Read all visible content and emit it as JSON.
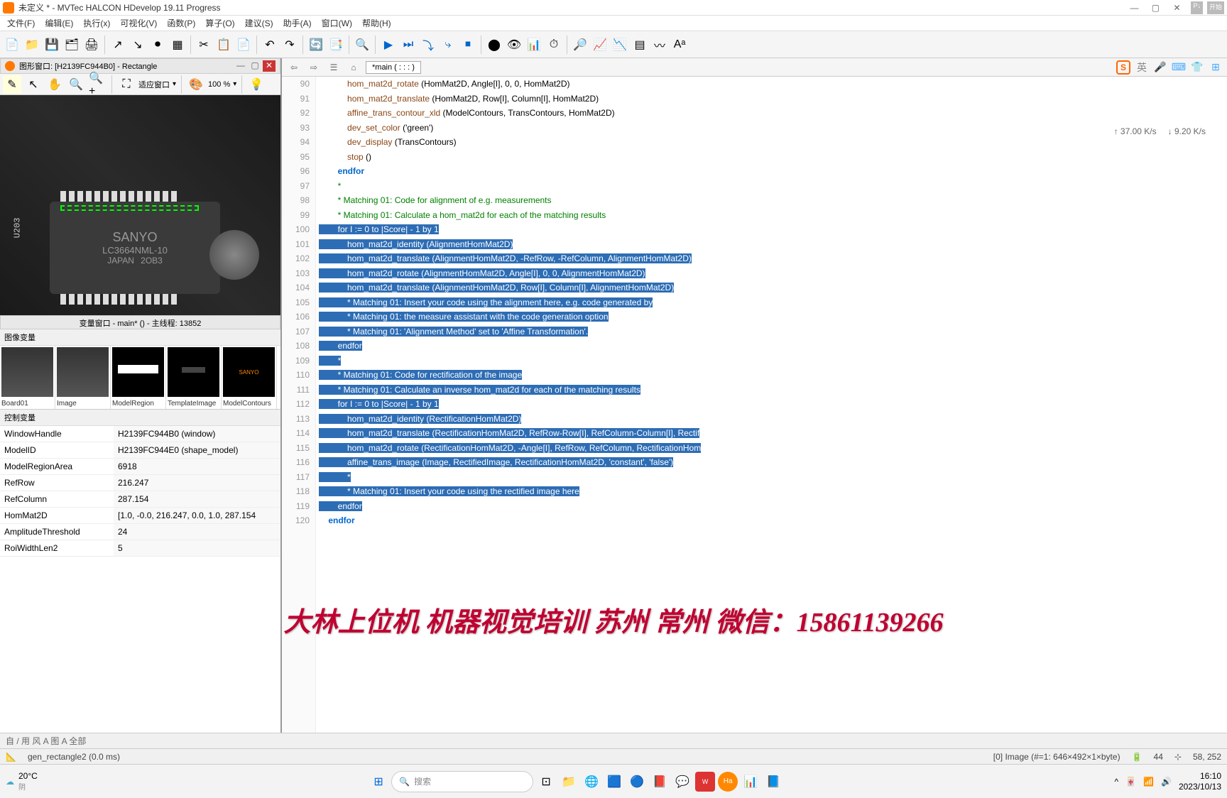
{
  "title": "未定义 * - MVTec HALCON HDevelop 19.11 Progress",
  "start_btn": "开始",
  "menu": [
    "文件(F)",
    "编辑(E)",
    "执行(x)",
    "可视化(V)",
    "函数(P)",
    "算子(O)",
    "建议(S)",
    "助手(A)",
    "窗口(W)",
    "帮助(H)"
  ],
  "graphics_window": {
    "title": "图形窗口: [H2139FC944B0] - Rectangle",
    "zoom": "100 %",
    "fit": "适应窗口"
  },
  "chip": {
    "brand": "SANYO",
    "part": "LC3664NML-10",
    "origin": "JAPAN",
    "code": "2OB3",
    "ref": "U203"
  },
  "var_window_title": "变量窗口 - main* () - 主线程: 13852",
  "thumbs": [
    {
      "label": "Board01"
    },
    {
      "label": "Image"
    },
    {
      "label": "ModelRegion"
    },
    {
      "label": "TemplateImage"
    },
    {
      "label": "ModelContours"
    }
  ],
  "img_var_label": "图像变量",
  "ctrl_var_label": "控制变量",
  "vars": [
    {
      "k": "WindowHandle",
      "v": "H2139FC944B0 (window)"
    },
    {
      "k": "ModelID",
      "v": "H2139FC944E0 (shape_model)"
    },
    {
      "k": "ModelRegionArea",
      "v": "6918"
    },
    {
      "k": "RefRow",
      "v": "216.247"
    },
    {
      "k": "RefColumn",
      "v": "287.154"
    },
    {
      "k": "HomMat2D",
      "v": "[1.0, -0.0, 216.247, 0.0, 1.0, 287.154"
    },
    {
      "k": "AmplitudeThreshold",
      "v": "24"
    },
    {
      "k": "RoiWidthLen2",
      "v": "5"
    }
  ],
  "code_tab": "*main ( : : : )",
  "netstat": {
    "up": "37.00 K/s",
    "down": "9.20 K/s"
  },
  "lang": "英",
  "lines": [
    {
      "n": 90,
      "t": "            hom_mat2d_rotate (HomMat2D, Angle[I], 0, 0, HomMat2D)",
      "sel": false
    },
    {
      "n": 91,
      "t": "            hom_mat2d_translate (HomMat2D, Row[I], Column[I], HomMat2D)",
      "sel": false
    },
    {
      "n": 92,
      "t": "            affine_trans_contour_xld (ModelContours, TransContours, HomMat2D)",
      "sel": false
    },
    {
      "n": 93,
      "t": "            dev_set_color ('green')",
      "sel": false
    },
    {
      "n": 94,
      "t": "            dev_display (TransContours)",
      "sel": false
    },
    {
      "n": 95,
      "t": "            stop ()",
      "sel": false
    },
    {
      "n": 96,
      "t": "        endfor",
      "sel": false,
      "kw": true
    },
    {
      "n": 97,
      "t": "        *",
      "sel": false,
      "cmt": true
    },
    {
      "n": 98,
      "t": "        * Matching 01: Code for alignment of e.g. measurements",
      "sel": false,
      "cmt": true
    },
    {
      "n": 99,
      "t": "        * Matching 01: Calculate a hom_mat2d for each of the matching results",
      "sel": false,
      "cmt": true
    },
    {
      "n": 100,
      "t": "        for I := 0 to |Score| - 1 by 1",
      "sel": true
    },
    {
      "n": 101,
      "t": "            hom_mat2d_identity (AlignmentHomMat2D)",
      "sel": true
    },
    {
      "n": 102,
      "t": "            hom_mat2d_translate (AlignmentHomMat2D, -RefRow, -RefColumn, AlignmentHomMat2D)",
      "sel": true
    },
    {
      "n": 103,
      "t": "            hom_mat2d_rotate (AlignmentHomMat2D, Angle[I], 0, 0, AlignmentHomMat2D)",
      "sel": true
    },
    {
      "n": 104,
      "t": "            hom_mat2d_translate (AlignmentHomMat2D, Row[I], Column[I], AlignmentHomMat2D)",
      "sel": true
    },
    {
      "n": 105,
      "t": "            * Matching 01: Insert your code using the alignment here, e.g. code generated by",
      "sel": true
    },
    {
      "n": 106,
      "t": "            * Matching 01: the measure assistant with the code generation option",
      "sel": true
    },
    {
      "n": 107,
      "t": "            * Matching 01: 'Alignment Method' set to 'Affine Transformation'.",
      "sel": true
    },
    {
      "n": 108,
      "t": "        endfor",
      "sel": true
    },
    {
      "n": 109,
      "t": "        *",
      "sel": true
    },
    {
      "n": 110,
      "t": "        * Matching 01: Code for rectification of the image",
      "sel": true
    },
    {
      "n": 111,
      "t": "        * Matching 01: Calculate an inverse hom_mat2d for each of the matching results",
      "sel": true
    },
    {
      "n": 112,
      "t": "        for I := 0 to |Score| - 1 by 1",
      "sel": true
    },
    {
      "n": 113,
      "t": "            hom_mat2d_identity (RectificationHomMat2D)",
      "sel": true
    },
    {
      "n": 114,
      "t": "            hom_mat2d_translate (RectificationHomMat2D, RefRow-Row[I], RefColumn-Column[I], Rectif",
      "sel": true
    },
    {
      "n": 115,
      "t": "            hom_mat2d_rotate (RectificationHomMat2D, -Angle[I], RefRow, RefColumn, RectificationHom",
      "sel": true
    },
    {
      "n": 116,
      "t": "            affine_trans_image (Image, RectifiedImage, RectificationHomMat2D, 'constant', 'false')",
      "sel": true
    },
    {
      "n": 117,
      "t": "            *",
      "sel": true
    },
    {
      "n": 118,
      "t": "            * Matching 01: Insert your code using the rectified image here",
      "sel": true
    },
    {
      "n": 119,
      "t": "        endfor",
      "sel": true
    },
    {
      "n": 120,
      "t": "    endfor",
      "sel": false,
      "kw": true
    }
  ],
  "bottombar_tabs": "自 / 用 风 A 图 A 全部",
  "status": {
    "func": "gen_rectangle2 (0.0 ms)",
    "img": "[0] Image (#=1: 646×492×1×byte)",
    "batt": "44",
    "coords": "58, 252"
  },
  "overlay": "大林上位机 机器视觉培训 苏州 常州  微信：15861139266",
  "taskbar": {
    "temp": "20°C",
    "weather": "阴",
    "search": "搜索",
    "time": "16:10",
    "date": "2023/10/13"
  }
}
